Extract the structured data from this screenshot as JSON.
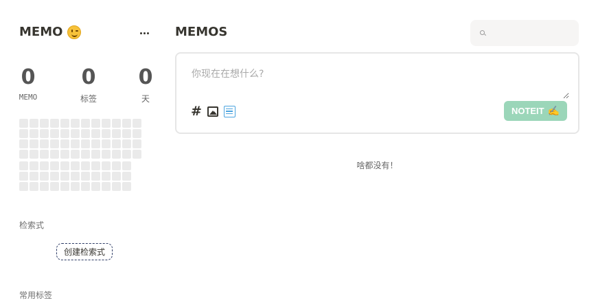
{
  "sidebar": {
    "brand": "MEMO",
    "brand_emoji": "wink-face-icon",
    "stats": [
      {
        "value": "0",
        "label": "MEMO"
      },
      {
        "value": "0",
        "label": "标签"
      },
      {
        "value": "0",
        "label": "天"
      }
    ],
    "query_section_title": "检索式",
    "create_query_label": "创建检索式",
    "tags_section_title": "常用标签"
  },
  "main": {
    "title": "MEMOS",
    "search": {
      "placeholder": "",
      "value": ""
    },
    "editor": {
      "placeholder": "你现在在想什么?",
      "tools": [
        "hash-icon",
        "image-icon",
        "list-icon"
      ],
      "send_label": "NOTEIT"
    },
    "empty_message": "啥都没有！"
  },
  "colors": {
    "send_button": "#9bd6b9",
    "heatmap_cell": "#eaeaea",
    "list_icon": "#4aa3df"
  }
}
